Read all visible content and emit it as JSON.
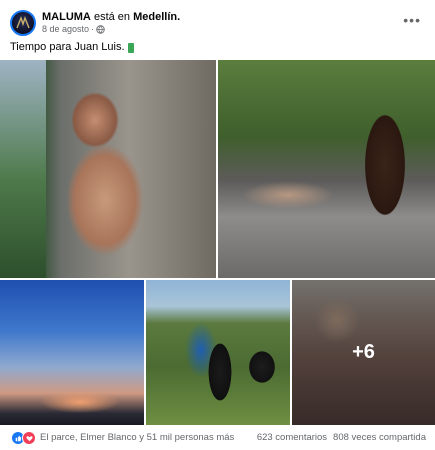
{
  "post": {
    "author": "MALUMA",
    "location_prefix": "está en",
    "location": "Medellín.",
    "date": "8 de agosto",
    "separator": "·",
    "caption": "Tiempo para Juan Luis.",
    "more_label": "•••"
  },
  "gallery": {
    "extra_count": "+6"
  },
  "footer": {
    "reactions_text": "El parce, Elmer Blanco y 51 mil personas más",
    "comments": "623 comentarios",
    "shares": "808 veces compartida",
    "reaction_icons": [
      "like-icon",
      "love-icon"
    ]
  },
  "colors": {
    "accent": "#1877f2",
    "love": "#f33e58",
    "muted_text": "#65676b"
  }
}
